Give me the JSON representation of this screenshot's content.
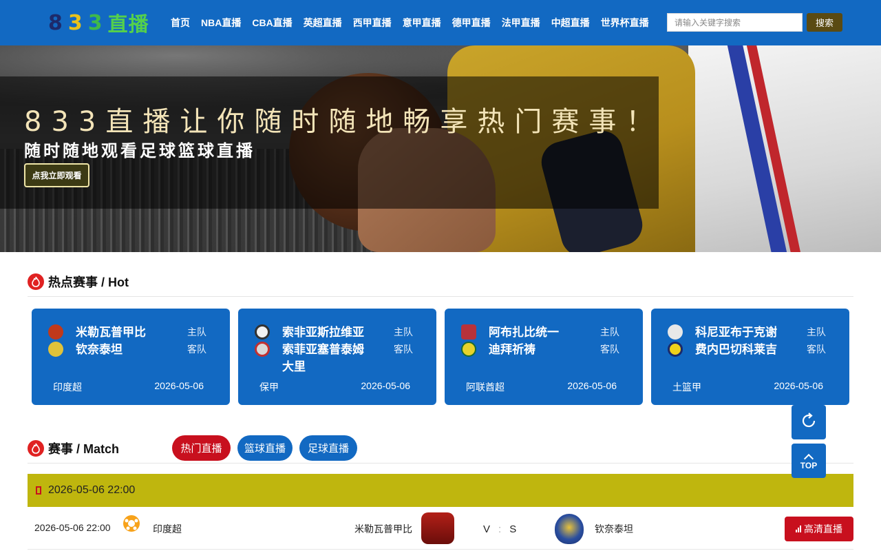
{
  "header": {
    "logo": {
      "digit1": "8",
      "digit2": "3",
      "digit3": "3",
      "text": "直播"
    },
    "nav": [
      "首页",
      "NBA直播",
      "CBA直播",
      "英超直播",
      "西甲直播",
      "意甲直播",
      "德甲直播",
      "法甲直播",
      "中超直播",
      "世界杯直播"
    ],
    "search": {
      "placeholder": "请输入关键字搜索",
      "button": "搜索"
    }
  },
  "banner": {
    "headline": "833直播让你随时随地畅享热门赛事！",
    "subheadline": "随时随地观看足球篮球直播",
    "cta": "点我立即观看"
  },
  "hot": {
    "title": "热点赛事 / Hot",
    "home_label": "主队",
    "away_label": "客队",
    "cards": [
      {
        "home": "米勒瓦普甲比",
        "away": "钦奈泰坦",
        "league": "印度超",
        "date": "2026-05-06",
        "home_color": "#c0391b",
        "away_color": "#e0c23a"
      },
      {
        "home": "索非亚斯拉维亚",
        "away": "索菲亚塞普泰姆大里",
        "league": "保甲",
        "date": "2026-05-06",
        "home_color": "#f2f2f2",
        "away_color": "#d8d8d8"
      },
      {
        "home": "阿布扎比统一",
        "away": "迪拜祈祷",
        "league": "阿联酋超",
        "date": "2026-05-06",
        "home_color": "#b8323a",
        "away_color": "#e6d22a"
      },
      {
        "home": "科尼亚布于克谢",
        "away": "费内巴切科莱吉",
        "league": "土篮甲",
        "date": "2026-05-06",
        "home_color": "#e8e8e8",
        "away_color": "#f0d11a"
      }
    ]
  },
  "match": {
    "title": "赛事 / Match",
    "tabs": [
      {
        "label": "热门直播",
        "color": "#c8101e"
      },
      {
        "label": "篮球直播",
        "color": "#1269c2"
      },
      {
        "label": "足球直播",
        "color": "#1269c2"
      }
    ],
    "date_header": "2026-05-06 22:00",
    "rows": [
      {
        "time": "2026-05-06 22:00",
        "sport_icon": "soccer-ball-icon",
        "league": "印度超",
        "home": "米勒瓦普甲比",
        "v": "V",
        "s": "S",
        "away": "钦奈泰坦",
        "button": "高清直播"
      }
    ]
  },
  "floating": {
    "refresh_icon": "refresh-icon",
    "top_label": "TOP"
  }
}
